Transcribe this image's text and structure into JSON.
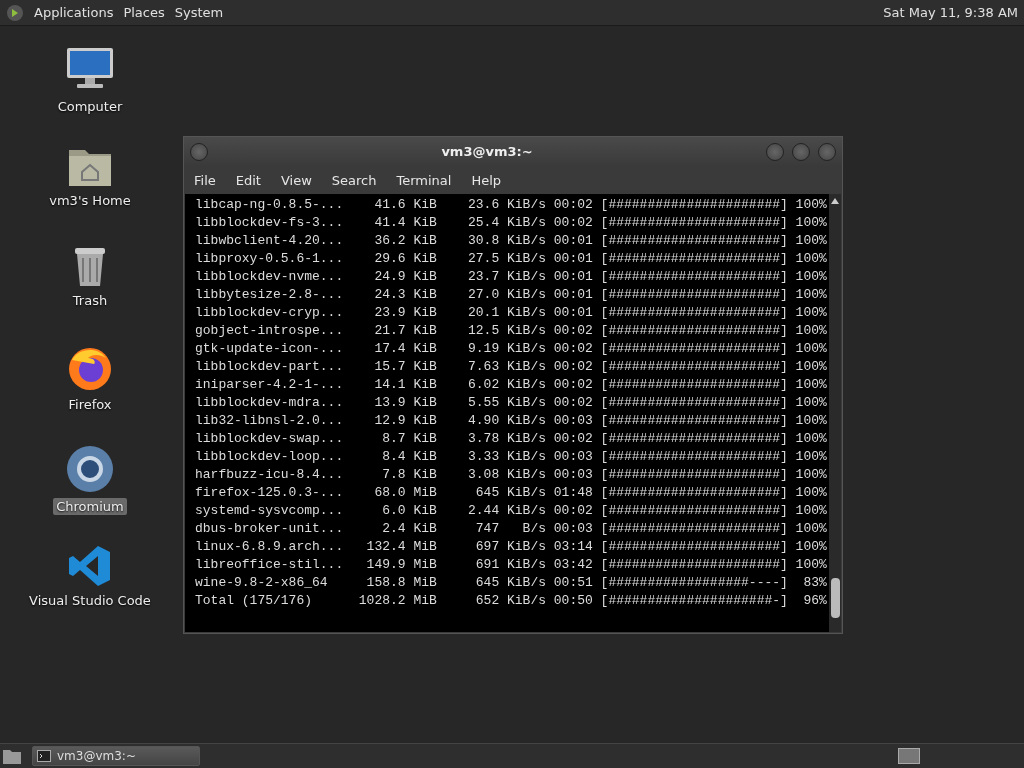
{
  "top_panel": {
    "menus": [
      "Applications",
      "Places",
      "System"
    ],
    "clock": "Sat May 11,  9:38 AM"
  },
  "desktop_icons": [
    {
      "kind": "computer",
      "label": "Computer",
      "selected": false
    },
    {
      "kind": "home",
      "label": "vm3's Home",
      "selected": false
    },
    {
      "kind": "trash",
      "label": "Trash",
      "selected": false
    },
    {
      "kind": "firefox",
      "label": "Firefox",
      "selected": false
    },
    {
      "kind": "chromium",
      "label": "Chromium",
      "selected": true
    },
    {
      "kind": "vscode",
      "label": "Visual Studio Code",
      "selected": false
    }
  ],
  "terminal": {
    "title": "vm3@vm3:~",
    "menu": [
      "File",
      "Edit",
      "View",
      "Search",
      "Terminal",
      "Help"
    ],
    "rows": [
      {
        "name": "libcap-ng-0.8.5-...",
        "size": "41.6 KiB",
        "rate": "23.6 KiB/s",
        "time": "00:02",
        "bar": "[######################]",
        "percent": "100%"
      },
      {
        "name": "libblockdev-fs-3...",
        "size": "41.4 KiB",
        "rate": "25.4 KiB/s",
        "time": "00:02",
        "bar": "[######################]",
        "percent": "100%"
      },
      {
        "name": "libwbclient-4.20...",
        "size": "36.2 KiB",
        "rate": "30.8 KiB/s",
        "time": "00:01",
        "bar": "[######################]",
        "percent": "100%"
      },
      {
        "name": "libproxy-0.5.6-1...",
        "size": "29.6 KiB",
        "rate": "27.5 KiB/s",
        "time": "00:01",
        "bar": "[######################]",
        "percent": "100%"
      },
      {
        "name": "libblockdev-nvme...",
        "size": "24.9 KiB",
        "rate": "23.7 KiB/s",
        "time": "00:01",
        "bar": "[######################]",
        "percent": "100%"
      },
      {
        "name": "libbytesize-2.8-...",
        "size": "24.3 KiB",
        "rate": "27.0 KiB/s",
        "time": "00:01",
        "bar": "[######################]",
        "percent": "100%"
      },
      {
        "name": "libblockdev-cryp...",
        "size": "23.9 KiB",
        "rate": "20.1 KiB/s",
        "time": "00:01",
        "bar": "[######################]",
        "percent": "100%"
      },
      {
        "name": "gobject-introspe...",
        "size": "21.7 KiB",
        "rate": "12.5 KiB/s",
        "time": "00:02",
        "bar": "[######################]",
        "percent": "100%"
      },
      {
        "name": "gtk-update-icon-...",
        "size": "17.4 KiB",
        "rate": "9.19 KiB/s",
        "time": "00:02",
        "bar": "[######################]",
        "percent": "100%"
      },
      {
        "name": "libblockdev-part...",
        "size": "15.7 KiB",
        "rate": "7.63 KiB/s",
        "time": "00:02",
        "bar": "[######################]",
        "percent": "100%"
      },
      {
        "name": "iniparser-4.2-1-...",
        "size": "14.1 KiB",
        "rate": "6.02 KiB/s",
        "time": "00:02",
        "bar": "[######################]",
        "percent": "100%"
      },
      {
        "name": "libblockdev-mdra...",
        "size": "13.9 KiB",
        "rate": "5.55 KiB/s",
        "time": "00:02",
        "bar": "[######################]",
        "percent": "100%"
      },
      {
        "name": "lib32-libnsl-2.0...",
        "size": "12.9 KiB",
        "rate": "4.90 KiB/s",
        "time": "00:03",
        "bar": "[######################]",
        "percent": "100%"
      },
      {
        "name": "libblockdev-swap...",
        "size": "8.7 KiB",
        "rate": "3.78 KiB/s",
        "time": "00:02",
        "bar": "[######################]",
        "percent": "100%"
      },
      {
        "name": "libblockdev-loop...",
        "size": "8.4 KiB",
        "rate": "3.33 KiB/s",
        "time": "00:03",
        "bar": "[######################]",
        "percent": "100%"
      },
      {
        "name": "harfbuzz-icu-8.4...",
        "size": "7.8 KiB",
        "rate": "3.08 KiB/s",
        "time": "00:03",
        "bar": "[######################]",
        "percent": "100%"
      },
      {
        "name": "firefox-125.0.3-...",
        "size": "68.0 MiB",
        "rate": "645 KiB/s",
        "time": "01:48",
        "bar": "[######################]",
        "percent": "100%"
      },
      {
        "name": "systemd-sysvcomp...",
        "size": "6.0 KiB",
        "rate": "2.44 KiB/s",
        "time": "00:02",
        "bar": "[######################]",
        "percent": "100%"
      },
      {
        "name": "dbus-broker-unit...",
        "size": "2.4 KiB",
        "rate": "747   B/s",
        "time": "00:03",
        "bar": "[######################]",
        "percent": "100%"
      },
      {
        "name": "linux-6.8.9.arch...",
        "size": "132.4 MiB",
        "rate": "697 KiB/s",
        "time": "03:14",
        "bar": "[######################]",
        "percent": "100%"
      },
      {
        "name": "libreoffice-stil...",
        "size": "149.9 MiB",
        "rate": "691 KiB/s",
        "time": "03:42",
        "bar": "[######################]",
        "percent": "100%"
      },
      {
        "name": "wine-9.8-2-x86_64",
        "size": "158.8 MiB",
        "rate": "645 KiB/s",
        "time": "00:51",
        "bar": "[##################----]",
        "percent": "83%"
      },
      {
        "name": "Total (175/176)",
        "size": "1028.2 MiB",
        "rate": "652 KiB/s",
        "time": "00:50",
        "bar": "[#####################-]",
        "percent": "96%"
      }
    ]
  },
  "taskbar": {
    "tasks": [
      {
        "label": "vm3@vm3:~",
        "selected": true
      }
    ]
  }
}
